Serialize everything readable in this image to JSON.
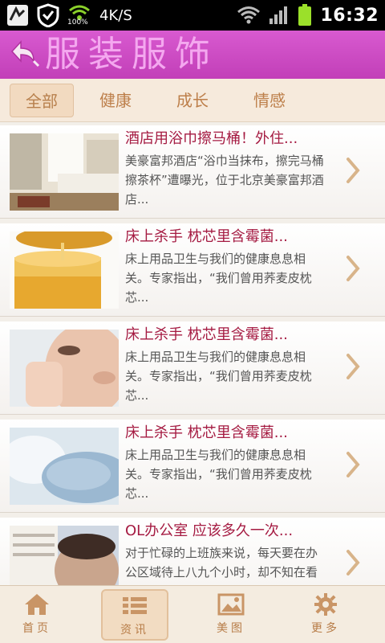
{
  "statusbar": {
    "net_speed": "4K/S",
    "time": "16:32",
    "signal_pct": "100%"
  },
  "header": {
    "title": "服装服饰"
  },
  "tabs": [
    {
      "label": "全部"
    },
    {
      "label": "健康"
    },
    {
      "label": "成长"
    },
    {
      "label": "情感"
    }
  ],
  "articles": [
    {
      "title": "酒店用浴巾擦马桶！外住...",
      "desc": "美豪富邦酒店“浴巾当抹布，擦完马桶擦茶杯”遭曝光，位于北京美豪富邦酒店..."
    },
    {
      "title": "床上杀手 枕芯里含霉菌...",
      "desc": "床上用品卫生与我们的健康息息相关。专家指出，“我们曾用荞麦皮枕芯..."
    },
    {
      "title": "床上杀手 枕芯里含霉菌...",
      "desc": "床上用品卫生与我们的健康息息相关。专家指出，“我们曾用荞麦皮枕芯..."
    },
    {
      "title": "床上杀手 枕芯里含霉菌...",
      "desc": "床上用品卫生与我们的健康息息相关。专家指出，“我们曾用荞麦皮枕芯..."
    },
    {
      "title": "OL办公室 应该多久一次...",
      "desc": "对于忙碌的上班族来说，每天要在办公区域待上八九个小时，却不知在看似洁净的..."
    }
  ],
  "bottomnav": [
    {
      "label": "首页",
      "icon": "home-icon"
    },
    {
      "label": "资讯",
      "icon": "list-icon"
    },
    {
      "label": "美图",
      "icon": "picture-icon"
    },
    {
      "label": "更多",
      "icon": "gear-icon"
    }
  ],
  "colors": {
    "header": "#c23fb8",
    "article_title": "#a51b42",
    "tab_text": "#bd7f4a",
    "battery": "#9be02a"
  }
}
